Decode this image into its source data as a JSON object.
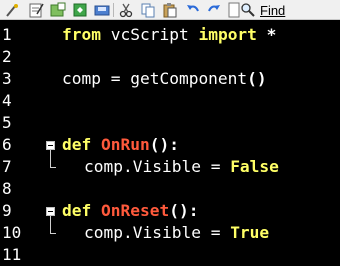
{
  "toolbar": {
    "find_label": "Find",
    "buttons": [
      "scissors-wand-icon",
      "script-icon",
      "new-document-icon",
      "open-icon",
      "save-icon",
      "cut-icon",
      "copy-icon",
      "paste-icon",
      "undo-icon",
      "redo-icon",
      "blank-page-icon",
      "find-icon"
    ]
  },
  "editor": {
    "line_numbers": [
      "1",
      "2",
      "3",
      "4",
      "5",
      "6",
      "7",
      "8",
      "9",
      "10",
      "11"
    ],
    "lines": {
      "l1": {
        "kw1": "from",
        "mid": " vcScript ",
        "kw2": "import",
        "end": " *"
      },
      "l3": {
        "text": "comp = getComponent",
        "parens": "()"
      },
      "l6": {
        "kw": "def",
        "fn": " OnRun",
        "punct": "():"
      },
      "l7": {
        "text": "comp.Visible = ",
        "val": "False"
      },
      "l9": {
        "kw": "def",
        "fn": " OnReset",
        "punct": "():"
      },
      "l10": {
        "text": "comp.Visible = ",
        "val": "True"
      }
    },
    "colors": {
      "background": "#000000",
      "keyword": "#ffff66",
      "function_name": "#ff5a3c",
      "text": "#ffffff"
    }
  }
}
